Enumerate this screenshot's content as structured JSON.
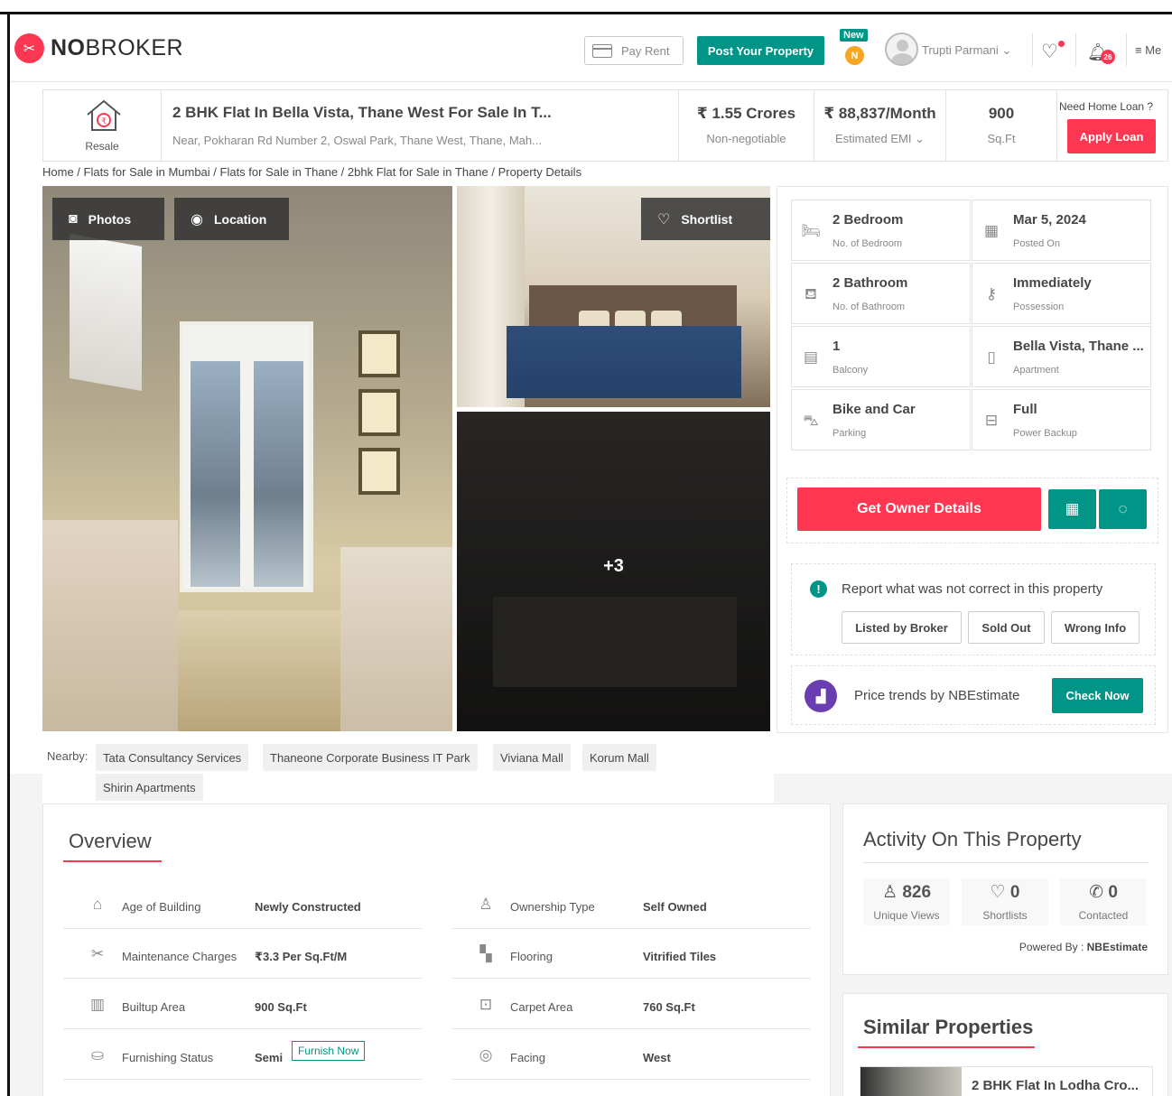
{
  "header": {
    "brand_bold": "NO",
    "brand_rest": "BROKER",
    "pay_rent": "Pay Rent",
    "post_property": "Post Your Property",
    "new_badge": "New",
    "coin_letter": "N",
    "user_name": "Trupti Parmani",
    "notification_count": "26",
    "menu_label": "Me"
  },
  "property": {
    "type_label": "Resale",
    "title": "2 BHK Flat In Bella Vista, Thane West For Sale In T...",
    "address": "Near, Pokharan Rd Number 2, Oswal Park, Thane West, Thane, Mah...",
    "price": "₹ 1.55 Crores",
    "price_note": "Non-negotiable",
    "emi": "₹ 88,837/Month",
    "emi_label": "Estimated EMI",
    "area": "900",
    "area_unit": "Sq.Ft",
    "loan_question": "Need Home Loan ?",
    "loan_button": "Apply Loan"
  },
  "breadcrumb": "Home / Flats for Sale in Mumbai / Flats for Sale in Thane / 2bhk Flat for Sale in Thane / Property Details",
  "gallery": {
    "photos_btn": "Photos",
    "location_btn": "Location",
    "shortlist_btn": "Shortlist",
    "more_count": "+3"
  },
  "specs": [
    {
      "value": "2 Bedroom",
      "label": "No. of Bedroom",
      "icon": "bed-icon"
    },
    {
      "value": "Mar 5, 2024",
      "label": "Posted On",
      "icon": "calendar-icon"
    },
    {
      "value": "2 Bathroom",
      "label": "No. of Bathroom",
      "icon": "bathtub-icon"
    },
    {
      "value": "Immediately",
      "label": "Possession",
      "icon": "key-icon"
    },
    {
      "value": "1",
      "label": "Balcony",
      "icon": "balcony-icon"
    },
    {
      "value": "Bella Vista, Thane ...",
      "label": "Apartment",
      "icon": "building-icon"
    },
    {
      "value": "Bike and Car",
      "label": "Parking",
      "icon": "car-icon"
    },
    {
      "value": "Full",
      "label": "Power Backup",
      "icon": "battery-icon"
    }
  ],
  "actions": {
    "owner_details": "Get Owner Details"
  },
  "report": {
    "text": "Report what was not correct in this property",
    "options": [
      "Listed by Broker",
      "Sold Out",
      "Wrong Info"
    ]
  },
  "trend": {
    "text": "Price trends by NBEstimate",
    "button": "Check Now"
  },
  "nearby": {
    "label": "Nearby:",
    "places": [
      "Tata Consultancy Services",
      "Thaneone Corporate Business IT Park",
      "Viviana Mall",
      "Korum Mall",
      "Shirin Apartments"
    ]
  },
  "overview": {
    "heading": "Overview",
    "rows": [
      {
        "label": "Age of Building",
        "value": "Newly Constructed",
        "icon": "cake-icon"
      },
      {
        "label": "Ownership Type",
        "value": "Self Owned",
        "icon": "owner-icon"
      },
      {
        "label": "Maintenance Charges",
        "value": "₹3.3 Per Sq.Ft/M",
        "icon": "tools-icon"
      },
      {
        "label": "Flooring",
        "value": "Vitrified Tiles",
        "icon": "tiles-icon"
      },
      {
        "label": "Builtup Area",
        "value": "900 Sq.Ft",
        "icon": "buildings-icon"
      },
      {
        "label": "Carpet Area",
        "value": "760 Sq.Ft",
        "icon": "carpet-icon"
      },
      {
        "label": "Furnishing Status",
        "value": "Semi",
        "icon": "sofa-icon"
      },
      {
        "label": "Facing",
        "value": "West",
        "icon": "compass-icon"
      }
    ],
    "furnish_now": "Furnish Now"
  },
  "activity": {
    "heading": "Activity On This Property",
    "stats": [
      {
        "value": "826",
        "label": "Unique Views",
        "icon": "user-icon"
      },
      {
        "value": "0",
        "label": "Shortlists",
        "icon": "heart-icon"
      },
      {
        "value": "0",
        "label": "Contacted",
        "icon": "phone-icon"
      }
    ],
    "powered_label": "Powered By :",
    "powered_by": "NBEstimate"
  },
  "similar": {
    "heading": "Similar Properties",
    "first_title": "2 BHK Flat In Lodha Cro..."
  },
  "colors": {
    "brand_red": "#fd3752",
    "teal": "#009587",
    "purple": "#6a3db0"
  }
}
